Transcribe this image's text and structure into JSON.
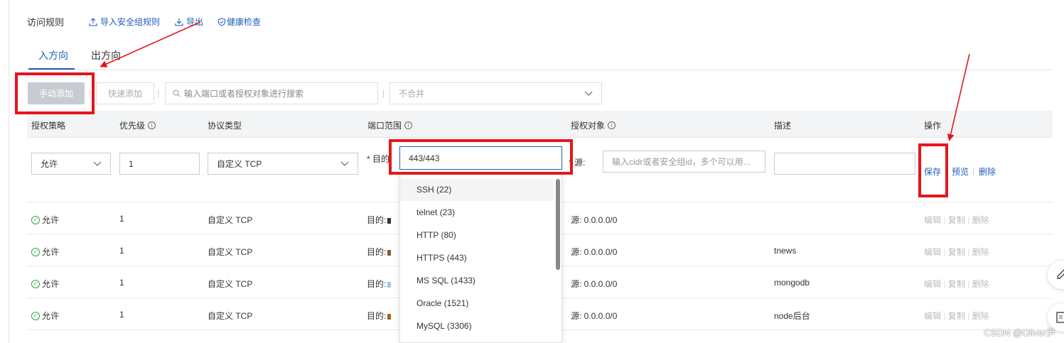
{
  "header": {
    "title": "访问规则",
    "import_label": "导入安全组规则",
    "export_label": "导出",
    "health_label": "健康检查"
  },
  "tabs": [
    {
      "label": "入方向",
      "active": true
    },
    {
      "label": "出方向",
      "active": false
    }
  ],
  "toolbar": {
    "manual_add": "手动添加",
    "quick_add": "快速添加",
    "search_placeholder": "输入端口或者授权对象进行搜索",
    "merge_select": "不合并"
  },
  "table": {
    "headers": {
      "policy": "授权策略",
      "priority": "优先级",
      "protocol": "协议类型",
      "port": "端口范围",
      "target": "授权对象",
      "desc": "描述",
      "actions": "操作"
    },
    "edit_row": {
      "policy": "允许",
      "priority": "1",
      "protocol": "自定义 TCP",
      "port_prefix": "* 目的:",
      "port_value": "443/443",
      "source_prefix": "* 源:",
      "source_placeholder": "输入cidr或者安全组id，多个可以用...",
      "desc_value": "",
      "save": "保存",
      "preview": "预览",
      "delete": "删除"
    },
    "rows": [
      {
        "policy": "允许",
        "priority": "1",
        "protocol": "自定义 TCP",
        "port": "目的:",
        "source": "源: 0.0.0.0/0",
        "desc": ""
      },
      {
        "policy": "允许",
        "priority": "1",
        "protocol": "自定义 TCP",
        "port": "目的:",
        "source": "源: 0.0.0.0/0",
        "desc": "tnews"
      },
      {
        "policy": "允许",
        "priority": "1",
        "protocol": "自定义 TCP",
        "port": "目的:",
        "source": "源: 0.0.0.0/0",
        "desc": "mongodb"
      },
      {
        "policy": "允许",
        "priority": "1",
        "protocol": "自定义 TCP",
        "port": "目的:",
        "source": "源: 0.0.0.0/0",
        "desc": "node后台"
      }
    ],
    "row_actions": {
      "edit": "编辑",
      "copy": "复制",
      "delete": "删除"
    }
  },
  "port_dropdown": [
    "SSH (22)",
    "telnet (23)",
    "HTTP (80)",
    "HTTPS (443)",
    "MS SQL (1433)",
    "Oracle (1521)",
    "MySQL (3306)"
  ],
  "watermark": "CSDN @Oliver尹",
  "colors": {
    "link": "#1f5fb8",
    "annotation": "#e5161b",
    "allow": "#2fa84f"
  }
}
